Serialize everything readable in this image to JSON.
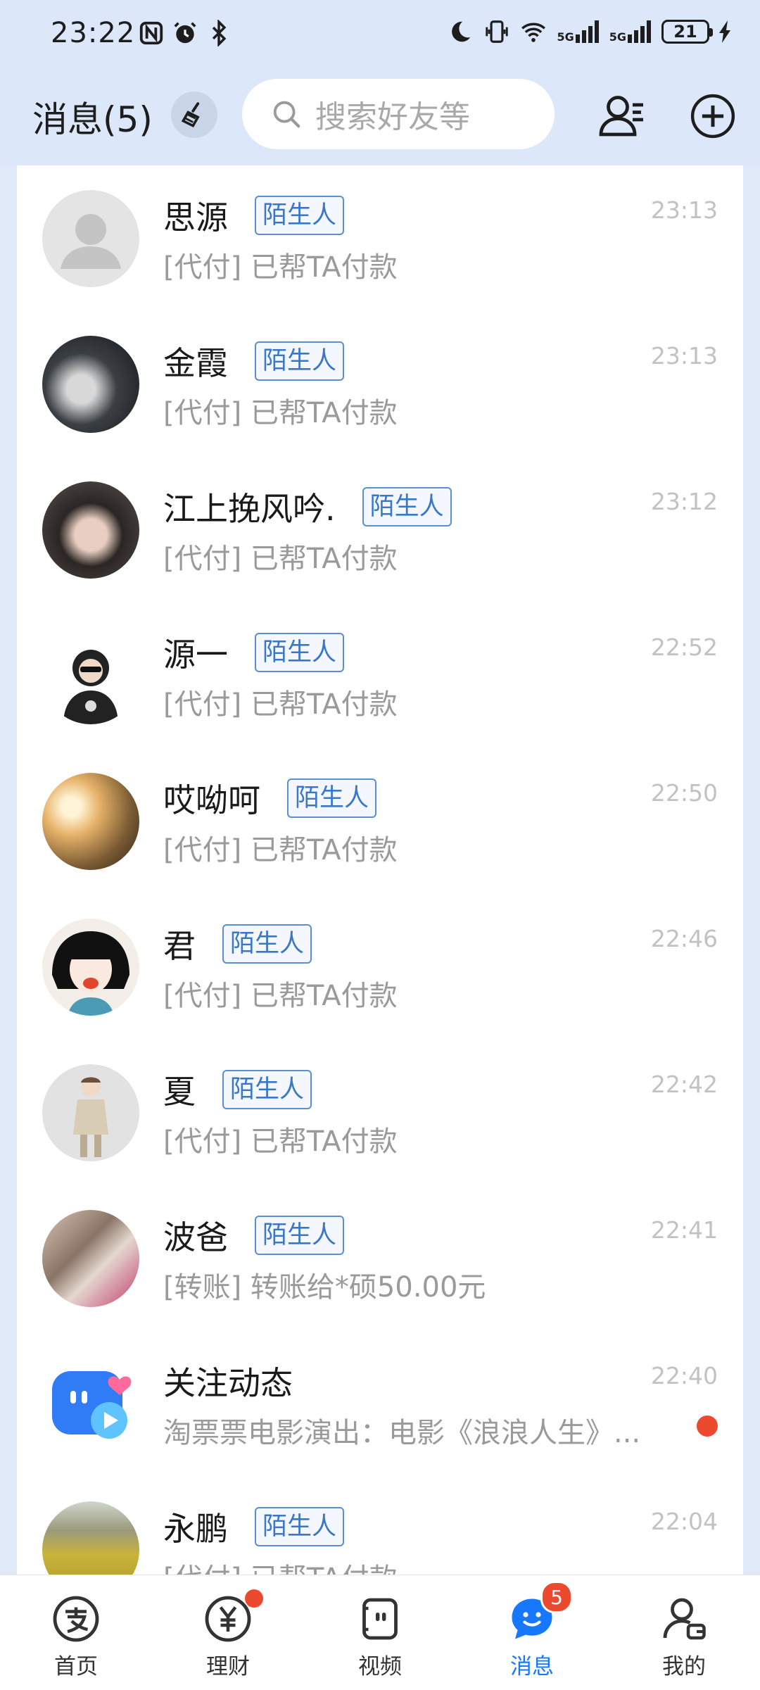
{
  "status_bar": {
    "time": "23:22",
    "network_5g_1": "5G",
    "network_5g_2": "5G",
    "battery": "21"
  },
  "header": {
    "title": "消息(5)",
    "search_placeholder": "搜索好友等"
  },
  "conversations": [
    {
      "name": "思源",
      "badge": "陌生人",
      "preview": "[代付] 已帮TA付款",
      "time": "23:13",
      "avatar": "default-avatar"
    },
    {
      "name": "金霞",
      "badge": "陌生人",
      "preview": "[代付] 已帮TA付款",
      "time": "23:13",
      "avatar": "photo-avatar"
    },
    {
      "name": "江上挽风吟.",
      "badge": "陌生人",
      "preview": "[代付] 已帮TA付款",
      "time": "23:12",
      "avatar": "photo-avatar"
    },
    {
      "name": "源一",
      "badge": "陌生人",
      "preview": "[代付] 已帮TA付款",
      "time": "22:52",
      "avatar": "photo-avatar"
    },
    {
      "name": "哎呦呵",
      "badge": "陌生人",
      "preview": "[代付] 已帮TA付款",
      "time": "22:50",
      "avatar": "photo-avatar"
    },
    {
      "name": "君",
      "badge": "陌生人",
      "preview": "[代付] 已帮TA付款",
      "time": "22:46",
      "avatar": "photo-avatar"
    },
    {
      "name": "夏",
      "badge": "陌生人",
      "preview": "[代付] 已帮TA付款",
      "time": "22:42",
      "avatar": "photo-avatar"
    },
    {
      "name": "波爸",
      "badge": "陌生人",
      "preview": "[转账] 转账给*硕50.00元",
      "time": "22:41",
      "avatar": "photo-avatar"
    },
    {
      "name": "关注动态",
      "badge": "",
      "preview": "淘票票电影演出：电影《浪浪人生》...",
      "time": "22:40",
      "avatar": "follow-app-icon",
      "unread": true
    },
    {
      "name": "永鹏",
      "badge": "陌生人",
      "preview": "[代付] 已帮TA付款",
      "time": "22:04",
      "avatar": "photo-avatar"
    }
  ],
  "bottom_nav": {
    "home": "首页",
    "finance": "理财",
    "video": "视频",
    "messages": "消息",
    "messages_count": "5",
    "mine": "我的"
  },
  "colors": {
    "header_bg": "#dce8f9",
    "accent": "#1677ff",
    "badge_text": "#3a78c7",
    "unread_dot": "#ec4a2f"
  }
}
